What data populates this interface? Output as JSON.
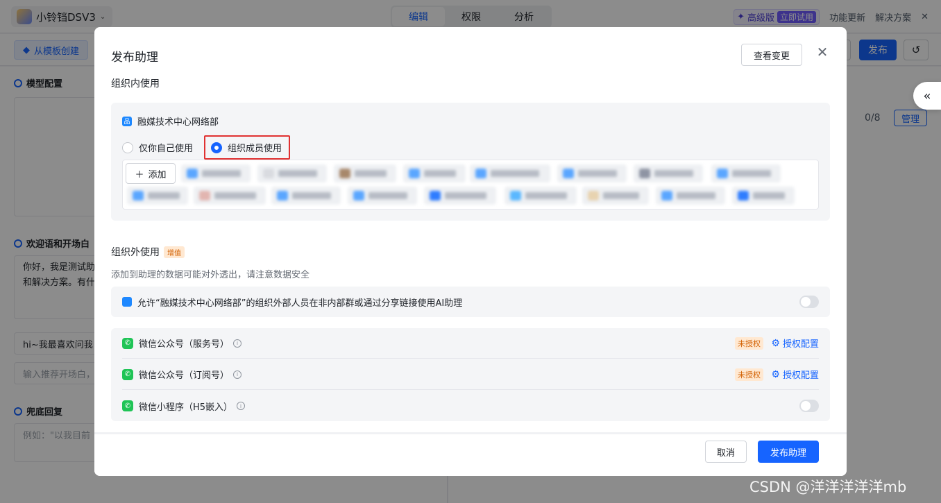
{
  "app": {
    "title": "小铃铛DSV3",
    "mode_tabs": [
      "编辑",
      "权限",
      "分析"
    ],
    "premium_label": "高级版",
    "premium_tag": "立即试用",
    "links": [
      "功能更新",
      "解决方案"
    ]
  },
  "toolbar": {
    "template_label": "从模板创建",
    "publish_label": "发布"
  },
  "left": {
    "model_config": "模型配置",
    "welcome_title": "欢迎语和开场白",
    "welcome_text_1": "你好，我是测试助",
    "welcome_text_2": "和解决方案。有什",
    "opener_value": "hi~我最喜欢问我",
    "opener_placeholder": "输入推荐开场白，",
    "fallback_title": "兜底回复",
    "fallback_placeholder": "例如：\"以我目前"
  },
  "right": {
    "count": "0/8",
    "manage_label": "管理"
  },
  "modal": {
    "title": "发布助理",
    "view_changes": "查看变更",
    "internal_heading": "组织内使用",
    "org_name": "融媒技术中心网络部",
    "radio_self": "仅你自己使用",
    "radio_members": "组织成员使用",
    "add_label": "添加",
    "external_heading": "组织外使用",
    "external_tag": "增值",
    "external_note": "添加到助理的数据可能对外透出，请注意数据安全",
    "allow_text": "允许“融媒技术中心网络部”的组织外部人员在非内部群或通过分享链接使用AI助理",
    "channels": [
      {
        "name": "微信公众号（服务号）",
        "status": "未授权",
        "action": "授权配置"
      },
      {
        "name": "微信公众号（订阅号）",
        "status": "未授权",
        "action": "授权配置"
      },
      {
        "name": "微信小程序（H5嵌入）"
      }
    ],
    "cancel_label": "取消",
    "publish_label": "发布助理"
  },
  "watermark": "CSDN @洋洋洋洋洋mb"
}
